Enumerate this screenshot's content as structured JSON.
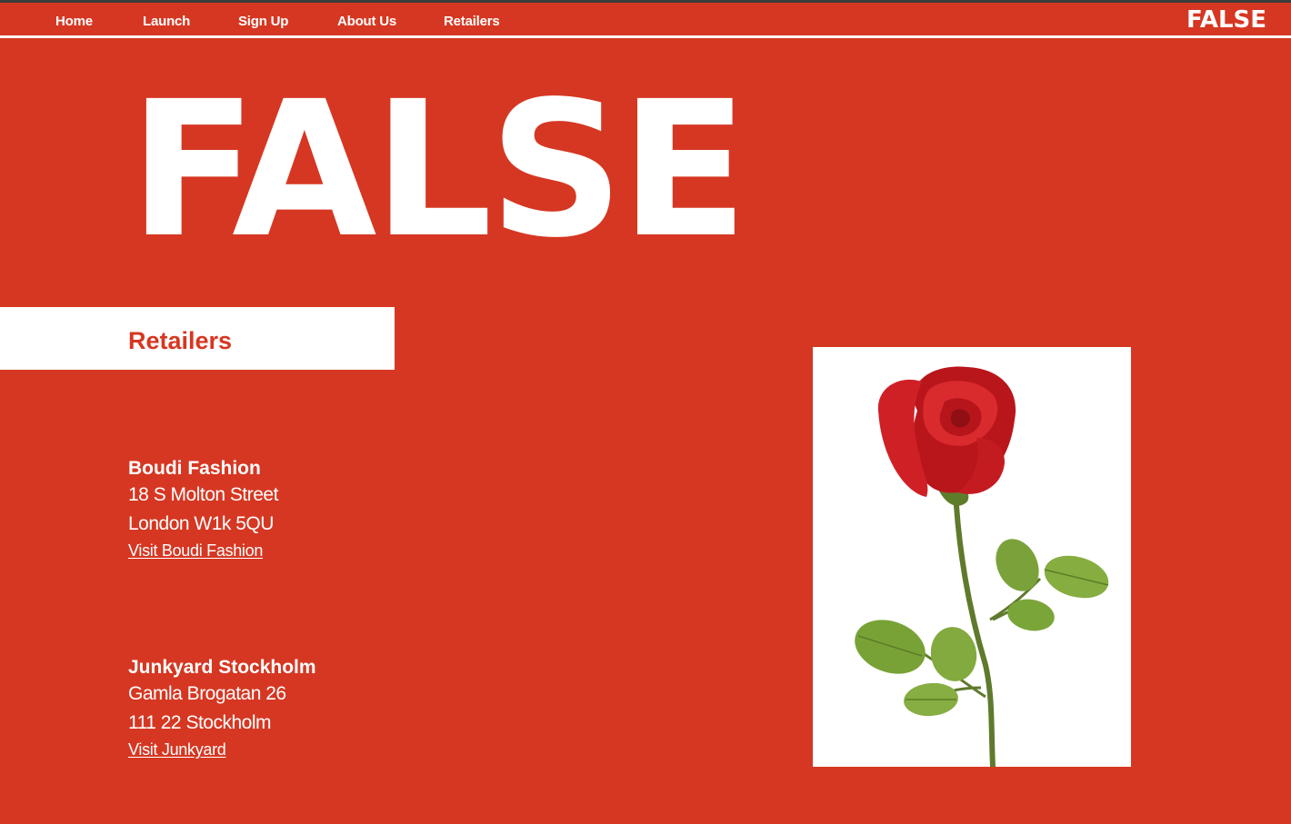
{
  "nav": {
    "items": [
      {
        "label": "Home"
      },
      {
        "label": "Launch"
      },
      {
        "label": "Sign Up"
      },
      {
        "label": "About Us"
      },
      {
        "label": "Retailers"
      }
    ],
    "logo": "FALSE"
  },
  "hero": {
    "title": "FALSE"
  },
  "section": {
    "heading": "Retailers"
  },
  "retailers": [
    {
      "name": "Boudi Fashion",
      "address_line1": "18 S Molton Street",
      "address_line2": "London W1k 5QU",
      "link_label": "Visit Boudi Fashion"
    },
    {
      "name": "Junkyard Stockholm",
      "address_line1": "Gamla Brogatan 26",
      "address_line2": "111 22 Stockholm",
      "link_label": "Visit Junkyard"
    }
  ],
  "image": {
    "subject": "rose-image"
  },
  "colors": {
    "background": "#d63722",
    "text": "#ffffff",
    "heading_accent": "#d63722",
    "top_strip": "#3c3c3c"
  }
}
